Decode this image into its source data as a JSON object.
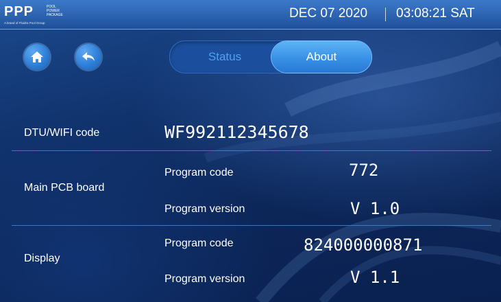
{
  "header": {
    "logo_mark": "PPP",
    "logo_lines": [
      "POOL",
      "POWER",
      "PACKAGE"
    ],
    "logo_sub": "A brand of Fluidra Pool Group",
    "date": "DEC 07 2020",
    "time": "03:08:21 SAT"
  },
  "nav": {
    "home_icon": "home-icon",
    "back_icon": "back-arrow-icon"
  },
  "tabs": {
    "status_label": "Status",
    "about_label": "About",
    "selected": "About"
  },
  "info": {
    "dtu": {
      "label": "DTU/WIFI code",
      "value": "WF992112345678"
    },
    "main_pcb": {
      "label": "Main PCB board",
      "program_code_label": "Program code",
      "program_code_value": "772",
      "program_version_label": "Program version",
      "program_version_value": "V 1.0"
    },
    "display": {
      "label": "Display",
      "program_code_label": "Program code",
      "program_code_value": "824000000871",
      "program_version_label": "Program version",
      "program_version_value": "V 1.1"
    }
  },
  "colors": {
    "topbar": "#2c63b0",
    "accent": "#3791e6",
    "background": "#0d2a5c",
    "divider": "#3f86d6"
  }
}
